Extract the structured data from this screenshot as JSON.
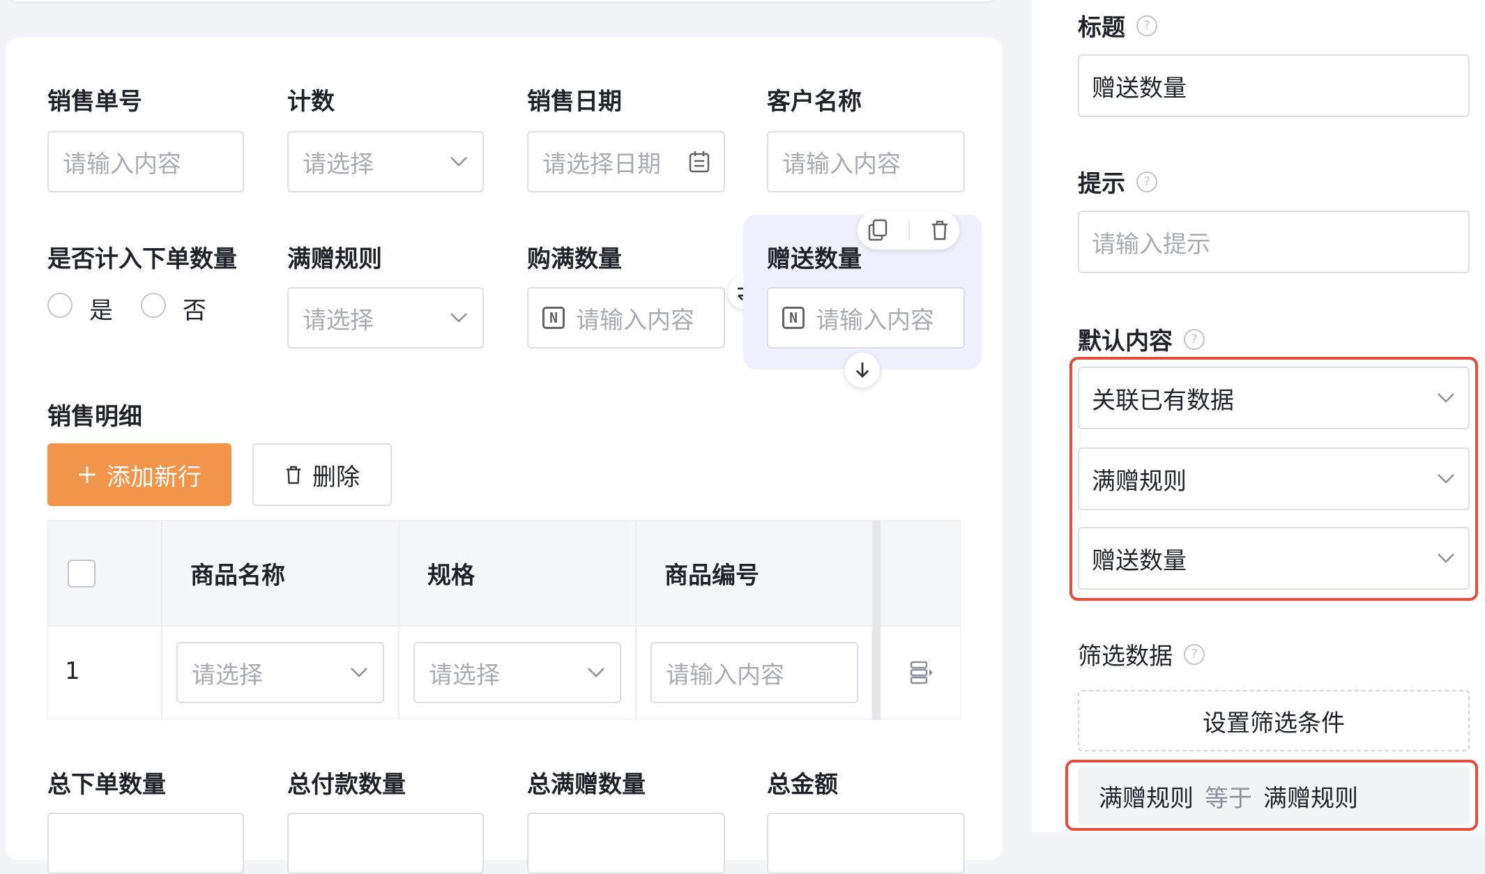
{
  "form": {
    "row1": [
      {
        "label": "销售单号",
        "placeholder": "请输入内容"
      },
      {
        "label": "计数",
        "placeholder": "请选择"
      },
      {
        "label": "销售日期",
        "placeholder": "请选择日期"
      },
      {
        "label": "客户名称",
        "placeholder": "请输入内容"
      }
    ],
    "row2": {
      "count_in_orders": {
        "label": "是否计入下单数量",
        "option_yes": "是",
        "option_no": "否"
      },
      "rule": {
        "label": "满赠规则",
        "placeholder": "请选择"
      },
      "full_qty": {
        "label": "购满数量",
        "placeholder": "请输入内容"
      },
      "gift_qty": {
        "label": "赠送数量",
        "placeholder": "请输入内容"
      }
    },
    "detail": {
      "label": "销售明细",
      "add_button": "添加新行",
      "delete_button": "删除",
      "columns": [
        "商品名称",
        "规格",
        "商品编号"
      ],
      "row": {
        "index": "1",
        "product_placeholder": "请选择",
        "spec_placeholder": "请选择",
        "code_placeholder": "请输入内容"
      }
    },
    "row3": [
      {
        "label": "总下单数量"
      },
      {
        "label": "总付款数量"
      },
      {
        "label": "总满赠数量"
      },
      {
        "label": "总金额"
      }
    ]
  },
  "panel": {
    "title_label": "标题",
    "title_value": "赠送数量",
    "hint_label": "提示",
    "hint_placeholder": "请输入提示",
    "default_label": "默认内容",
    "default_mode": "关联已有数据",
    "linked_form": "满赠规则",
    "linked_field": "赠送数量",
    "filter_label": "筛选数据",
    "filter_button": "设置筛选条件",
    "filter_condition": {
      "field": "满赠规则",
      "op": "等于",
      "value": "满赠规则"
    }
  },
  "colors": {
    "accent": "#f0954a",
    "highlight": "#e34d3b",
    "selected_bg": "#eef1fd"
  }
}
